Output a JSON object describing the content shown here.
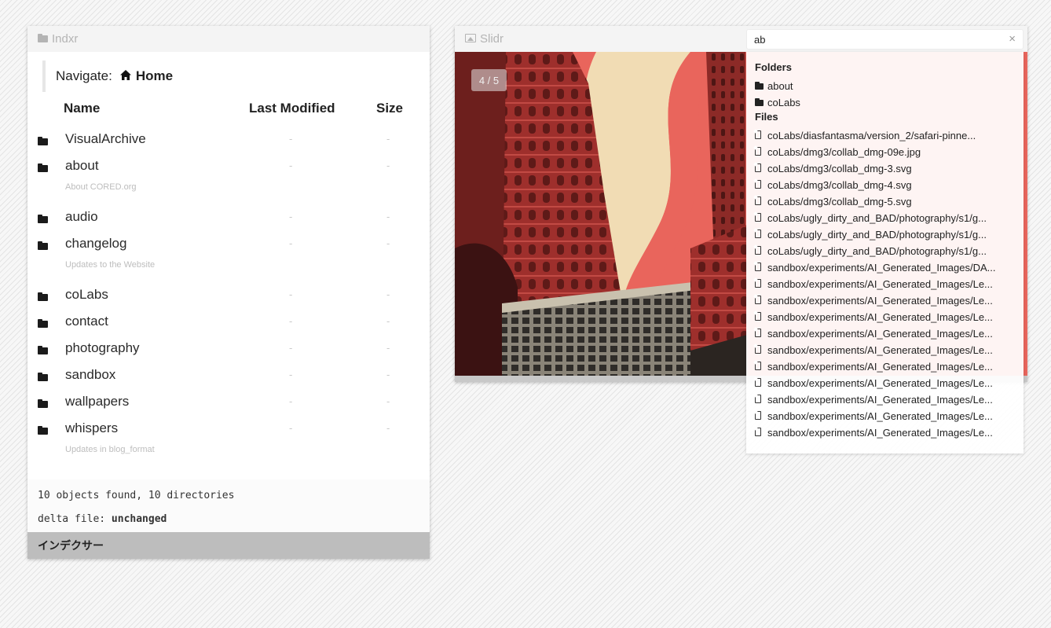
{
  "indxr": {
    "title": "Indxr",
    "navigate_label": "Navigate:",
    "home_label": "Home",
    "columns": {
      "name": "Name",
      "modified": "Last Modified",
      "size": "Size"
    },
    "rows": [
      {
        "name": "VisualArchive",
        "modified": "-",
        "size": "-",
        "desc": ""
      },
      {
        "name": "about",
        "modified": "-",
        "size": "-",
        "desc": "About CORED.org"
      },
      {
        "name": "audio",
        "modified": "-",
        "size": "-",
        "desc": ""
      },
      {
        "name": "changelog",
        "modified": "-",
        "size": "-",
        "desc": "Updates to the Website"
      },
      {
        "name": "coLabs",
        "modified": "-",
        "size": "-",
        "desc": ""
      },
      {
        "name": "contact",
        "modified": "-",
        "size": "-",
        "desc": ""
      },
      {
        "name": "photography",
        "modified": "-",
        "size": "-",
        "desc": ""
      },
      {
        "name": "sandbox",
        "modified": "-",
        "size": "-",
        "desc": ""
      },
      {
        "name": "wallpapers",
        "modified": "-",
        "size": "-",
        "desc": ""
      },
      {
        "name": "whispers",
        "modified": "-",
        "size": "-",
        "desc": "Updates in blog_format"
      }
    ],
    "summary": "10 objects found, 10 directories",
    "delta_label": "delta file:",
    "delta_value": "unchanged",
    "footer_title": "インデクサー"
  },
  "slidr": {
    "title": "Slidr",
    "counter": "4 / 5"
  },
  "search": {
    "value": "ab",
    "clear_icon": "×",
    "folders_label": "Folders",
    "folders": [
      "about",
      "coLabs"
    ],
    "files_label": "Files",
    "files": [
      "coLabs/diasfantasma/version_2/safari-pinne...",
      "coLabs/dmg3/collab_dmg-09e.jpg",
      "coLabs/dmg3/collab_dmg-3.svg",
      "coLabs/dmg3/collab_dmg-4.svg",
      "coLabs/dmg3/collab_dmg-5.svg",
      "coLabs/ugly_dirty_and_BAD/photography/s1/g...",
      "coLabs/ugly_dirty_and_BAD/photography/s1/g...",
      "coLabs/ugly_dirty_and_BAD/photography/s1/g...",
      "sandbox/experiments/AI_Generated_Images/DA...",
      "sandbox/experiments/AI_Generated_Images/Le...",
      "sandbox/experiments/AI_Generated_Images/Le...",
      "sandbox/experiments/AI_Generated_Images/Le...",
      "sandbox/experiments/AI_Generated_Images/Le...",
      "sandbox/experiments/AI_Generated_Images/Le...",
      "sandbox/experiments/AI_Generated_Images/Le...",
      "sandbox/experiments/AI_Generated_Images/Le...",
      "sandbox/experiments/AI_Generated_Images/Le...",
      "sandbox/experiments/AI_Generated_Images/Le...",
      "sandbox/experiments/AI_Generated_Images/Le..."
    ]
  },
  "colors": {
    "page_bg": "#f3f3f3",
    "titlebar_bg": "#f4f4f4",
    "footer_bar": "#bdbdbd",
    "poster_red": "#b33a35",
    "poster_cream": "#f1dcb4",
    "poster_salmon": "#e9655c"
  }
}
